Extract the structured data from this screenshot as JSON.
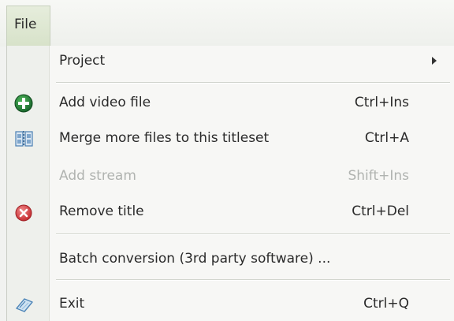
{
  "menubar": {
    "file_label": "File"
  },
  "menu": {
    "project": {
      "label": "Project"
    },
    "add_video": {
      "label": "Add video file",
      "shortcut": "Ctrl+Ins",
      "icon": "add-icon"
    },
    "merge": {
      "label": "Merge more files to this titleset",
      "shortcut": "Ctrl+A",
      "icon": "merge-icon"
    },
    "add_stream": {
      "label": "Add stream",
      "shortcut": "Shift+Ins",
      "disabled": true
    },
    "remove_title": {
      "label": "Remove title",
      "shortcut": "Ctrl+Del",
      "icon": "remove-icon"
    },
    "batch": {
      "label": "Batch conversion (3rd party software) ..."
    },
    "exit": {
      "label": "Exit",
      "shortcut": "Ctrl+Q",
      "icon": "exit-icon"
    }
  },
  "colors": {
    "add_icon": "#1f7a2a",
    "remove_icon": "#d63a3a",
    "merge_icon": "#4a7fb3"
  }
}
